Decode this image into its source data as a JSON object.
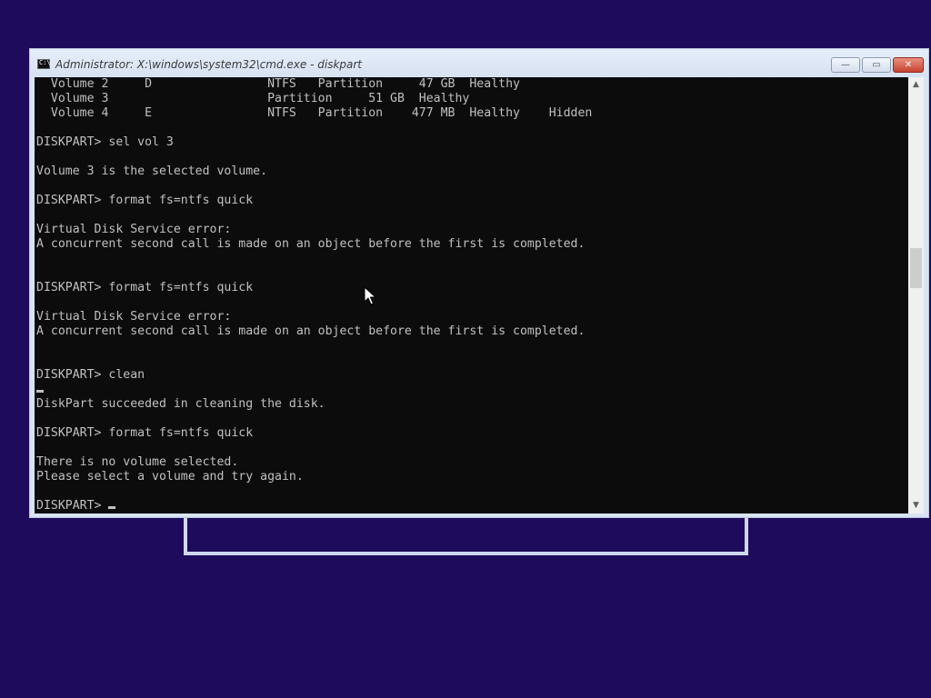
{
  "window": {
    "title": "Administrator: X:\\windows\\system32\\cmd.exe - diskpart",
    "icon_label": "C:\\",
    "controls": {
      "minimize": "—",
      "maximize": "▭",
      "close": "✕"
    }
  },
  "console": {
    "text": "  Volume 2     D                NTFS   Partition     47 GB  Healthy\n  Volume 3                      Partition     51 GB  Healthy\n  Volume 4     E                NTFS   Partition    477 MB  Healthy    Hidden\n\nDISKPART> sel vol 3\n\nVolume 3 is the selected volume.\n\nDISKPART> format fs=ntfs quick\n\nVirtual Disk Service error:\nA concurrent second call is made on an object before the first is completed.\n\n\nDISKPART> format fs=ntfs quick\n\nVirtual Disk Service error:\nA concurrent second call is made on an object before the first is completed.\n\n\nDISKPART> clean\n\nDiskPart succeeded in cleaning the disk.\n\nDISKPART> format fs=ntfs quick\n\nThere is no volume selected.\nPlease select a volume and try again.\n\n",
    "prompt": "DISKPART> ",
    "colors": {
      "background": "#0c0c0c",
      "foreground": "#c0c0c0"
    }
  },
  "scrollbar": {
    "up_arrow": "▲",
    "down_arrow": "▼"
  },
  "desktop": {
    "background_color": "#1f0b5c"
  }
}
